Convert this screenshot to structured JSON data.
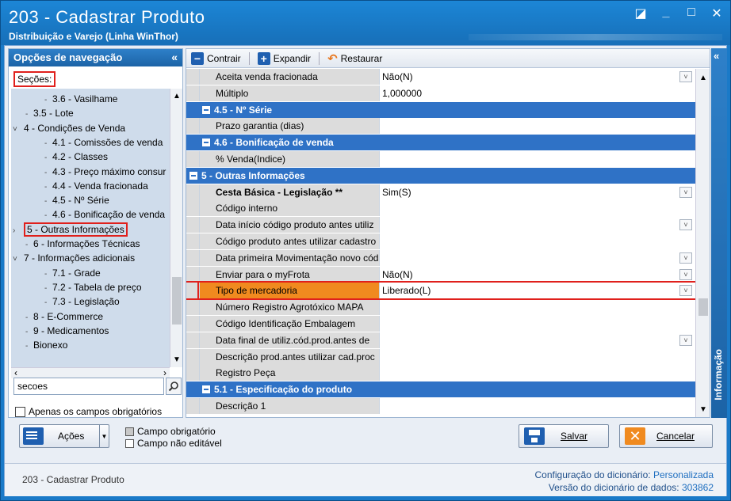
{
  "window": {
    "title": "203 - Cadastrar  Produto",
    "subtitle": "Distribuição e Varejo (Linha WinThor)",
    "controls": [
      "◪",
      "_",
      "□",
      "✕"
    ]
  },
  "nav": {
    "header": "Opções de navegação",
    "collapse_glyph": "«",
    "secoes_label": "Seções:",
    "tree": [
      {
        "label": "3.6 - Vasilhame",
        "level": 2,
        "exp": ""
      },
      {
        "label": "3.5 - Lote",
        "level": 1,
        "exp": ""
      },
      {
        "label": "4 - Condições de Venda",
        "level": 0,
        "exp": "v"
      },
      {
        "label": "4.1 - Comissões de venda",
        "level": 2,
        "exp": ""
      },
      {
        "label": "4.2 - Classes",
        "level": 2,
        "exp": ""
      },
      {
        "label": "4.3 - Preço máximo consur",
        "level": 2,
        "exp": ""
      },
      {
        "label": "4.4 - Venda fracionada",
        "level": 2,
        "exp": ""
      },
      {
        "label": "4.5 - Nº Série",
        "level": 2,
        "exp": ""
      },
      {
        "label": "4.6 - Bonificação de venda",
        "level": 2,
        "exp": ""
      },
      {
        "label": "5 - Outras Informações",
        "level": 0,
        "exp": ">",
        "selected": true
      },
      {
        "label": "6 - Informações Técnicas",
        "level": 1,
        "exp": ""
      },
      {
        "label": "7 - Informações adicionais",
        "level": 0,
        "exp": "v"
      },
      {
        "label": "7.1 - Grade",
        "level": 2,
        "exp": ""
      },
      {
        "label": "7.2 - Tabela de preço",
        "level": 2,
        "exp": ""
      },
      {
        "label": "7.3 - Legislação",
        "level": 2,
        "exp": ""
      },
      {
        "label": "8 - E-Commerce",
        "level": 1,
        "exp": ""
      },
      {
        "label": "9 - Medicamentos",
        "level": 1,
        "exp": ""
      },
      {
        "label": "Bionexo",
        "level": 1,
        "exp": ""
      }
    ],
    "search_value": "secoes",
    "only_required_label": "Apenas os campos obrigatórios"
  },
  "toolbar": {
    "contrair": "Contrair",
    "expandir": "Expandir",
    "restaurar": "Restaurar"
  },
  "grid": {
    "rows": [
      {
        "type": "row",
        "label": "Aceita venda fracionada",
        "value": "Não(N)",
        "dropdown": true
      },
      {
        "type": "row",
        "label": "Múltiplo",
        "value": "1,000000",
        "dropdown": false
      },
      {
        "type": "section",
        "label": "4.5 - Nº Série",
        "sub": true
      },
      {
        "type": "row",
        "label": "Prazo garantia (dias)",
        "value": "",
        "dropdown": false
      },
      {
        "type": "section",
        "label": "4.6 - Bonificação de venda",
        "sub": true
      },
      {
        "type": "row",
        "label": "% Venda(Indice)",
        "value": "",
        "dropdown": false
      },
      {
        "type": "section",
        "label": "5 - Outras Informações",
        "sub": false
      },
      {
        "type": "row",
        "label": "Cesta Básica - Legislação **",
        "value": "Sim(S)",
        "dropdown": true,
        "bold": true
      },
      {
        "type": "row",
        "label": "Código interno",
        "value": "",
        "dropdown": false
      },
      {
        "type": "row",
        "label": "Data início código produto antes utiliz",
        "value": "",
        "dropdown": true
      },
      {
        "type": "row",
        "label": "Código produto antes utilizar cadastro",
        "value": "",
        "dropdown": false
      },
      {
        "type": "row",
        "label": "Data primeira Movimentação novo cód",
        "value": "",
        "dropdown": true
      },
      {
        "type": "row",
        "label": "Enviar para o myFrota",
        "value": "Não(N)",
        "dropdown": true
      },
      {
        "type": "row",
        "label": "Tipo de mercadoria",
        "value": "Liberado(L)",
        "dropdown": true,
        "highlight": true
      },
      {
        "type": "row",
        "label": "Número Registro Agrotóxico MAPA",
        "value": "",
        "dropdown": false
      },
      {
        "type": "row",
        "label": "Código Identificação Embalagem",
        "value": "",
        "dropdown": false
      },
      {
        "type": "row",
        "label": "Data final de utiliz.cód.prod.antes de",
        "value": "",
        "dropdown": true
      },
      {
        "type": "row",
        "label": "Descrição prod.antes utilizar cad.proc",
        "value": "",
        "dropdown": false
      },
      {
        "type": "row",
        "label": "Registro Peça",
        "value": "",
        "dropdown": false
      },
      {
        "type": "section",
        "label": "5.1 - Especificação do produto",
        "sub": true
      },
      {
        "type": "row",
        "label": "Descrição 1",
        "value": "",
        "dropdown": false
      }
    ]
  },
  "info_strip": {
    "label": "Informação",
    "glyph": "«"
  },
  "bottom": {
    "acoes": "Ações",
    "legend_required": "Campo obrigatório",
    "legend_readonly": "Campo não editável",
    "salvar": "Salvar",
    "cancelar": "Cancelar"
  },
  "status": {
    "left": "203 - Cadastrar  Produto",
    "config_label": "Configuração do dicionário:",
    "config_value": "Personalizada",
    "version_label": "Versão do dicionário de dados:",
    "version_value": "303862"
  }
}
